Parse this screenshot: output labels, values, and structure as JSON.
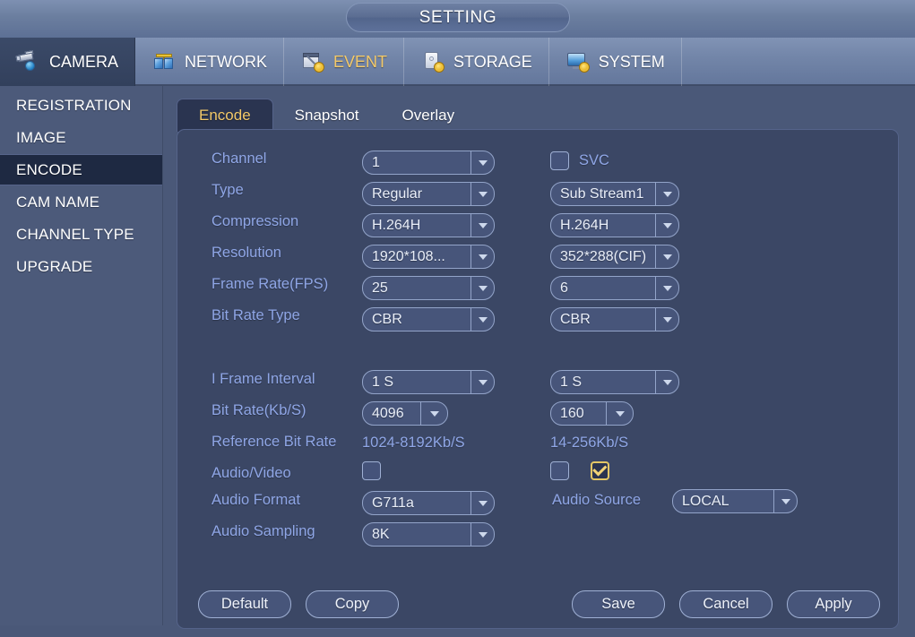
{
  "window": {
    "title": "SETTING"
  },
  "nav": {
    "items": [
      {
        "label": "CAMERA",
        "icon": "camera-icon",
        "active": true,
        "highlight": false
      },
      {
        "label": "NETWORK",
        "icon": "network-icon",
        "active": false,
        "highlight": false
      },
      {
        "label": "EVENT",
        "icon": "event-icon",
        "active": false,
        "highlight": true
      },
      {
        "label": "STORAGE",
        "icon": "storage-icon",
        "active": false,
        "highlight": false
      },
      {
        "label": "SYSTEM",
        "icon": "system-icon",
        "active": false,
        "highlight": false
      }
    ]
  },
  "sidebar": {
    "items": [
      {
        "label": "REGISTRATION",
        "active": false
      },
      {
        "label": "IMAGE",
        "active": false
      },
      {
        "label": "ENCODE",
        "active": true
      },
      {
        "label": "CAM NAME",
        "active": false
      },
      {
        "label": "CHANNEL TYPE",
        "active": false
      },
      {
        "label": "UPGRADE",
        "active": false
      }
    ]
  },
  "tabs": [
    {
      "label": "Encode",
      "active": true
    },
    {
      "label": "Snapshot",
      "active": false
    },
    {
      "label": "Overlay",
      "active": false
    }
  ],
  "form": {
    "labels": {
      "channel": "Channel",
      "type": "Type",
      "compression": "Compression",
      "resolution": "Resolution",
      "frame_rate": "Frame Rate(FPS)",
      "bit_rate_type": "Bit Rate Type",
      "i_frame_interval": "I Frame Interval",
      "bit_rate": "Bit Rate(Kb/S)",
      "reference_bit_rate": "Reference Bit Rate",
      "audio_video": "Audio/Video",
      "audio_format": "Audio Format",
      "audio_sampling": "Audio Sampling",
      "audio_source": "Audio Source",
      "svc": "SVC"
    },
    "main_stream": {
      "channel": "1",
      "type": "Regular",
      "compression": "H.264H",
      "resolution": "1920*108...",
      "frame_rate": "25",
      "bit_rate_type": "CBR",
      "i_frame_interval": "1 S",
      "bit_rate": "4096",
      "reference_bit_rate": "1024-8192Kb/S",
      "audio_video_checked": false,
      "audio_format": "G711a",
      "audio_sampling": "8K"
    },
    "sub_stream": {
      "svc_checked": false,
      "stream": "Sub Stream1",
      "compression": "H.264H",
      "resolution": "352*288(CIF)",
      "frame_rate": "6",
      "bit_rate_type": "CBR",
      "i_frame_interval": "1 S",
      "bit_rate": "160",
      "reference_bit_rate": "14-256Kb/S",
      "video_checked": false,
      "audio_checked": true,
      "audio_source": "LOCAL"
    }
  },
  "buttons": {
    "default": "Default",
    "copy": "Copy",
    "save": "Save",
    "cancel": "Cancel",
    "apply": "Apply"
  },
  "colors": {
    "accent_yellow": "#f3c969",
    "label_blue": "#8fa6e6",
    "panel_bg": "#3b4765",
    "sidebar_bg": "#4c5a7a",
    "active_item_bg": "#1e2942"
  }
}
